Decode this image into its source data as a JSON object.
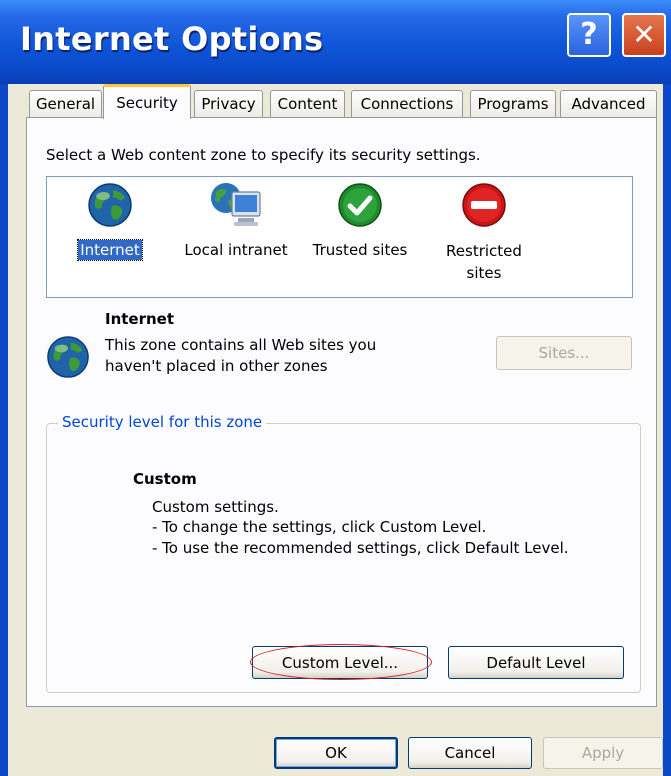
{
  "window": {
    "title": "Internet Options"
  },
  "title_buttons": {
    "help_glyph": "?",
    "close_glyph": "✕"
  },
  "tabs": [
    {
      "label": "General"
    },
    {
      "label": "Security",
      "active": true
    },
    {
      "label": "Privacy"
    },
    {
      "label": "Content"
    },
    {
      "label": "Connections"
    },
    {
      "label": "Programs"
    },
    {
      "label": "Advanced"
    }
  ],
  "security": {
    "instruction": "Select a Web content zone to specify its security settings.",
    "zones": [
      {
        "label": "Internet",
        "icon": "globe-icon",
        "selected": true
      },
      {
        "label": "Local intranet",
        "icon": "computer-globe-icon"
      },
      {
        "label_line1": "Trusted sites",
        "icon": "checkmark-icon"
      },
      {
        "label_line1": "Restricted",
        "label_line2": "sites",
        "icon": "no-entry-icon"
      }
    ],
    "zone_info": {
      "name": "Internet",
      "desc_line1": "This zone contains all Web sites you",
      "desc_line2": "haven't placed in other zones",
      "sites_button": "Sites..."
    },
    "level_group": {
      "title": "Security level for this zone",
      "level_name": "Custom",
      "line1": "Custom settings.",
      "line2": "- To change the settings, click Custom Level.",
      "line3": "- To use the recommended settings, click Default Level.",
      "custom_level_button": "Custom Level...",
      "default_level_button": "Default Level"
    }
  },
  "footer": {
    "ok": "OK",
    "cancel": "Cancel",
    "apply": "Apply"
  },
  "colors": {
    "titlebar": "#0a48c8",
    "accent": "#316ac5",
    "group_title": "#0046d5",
    "highlight": "#d81e1e"
  }
}
